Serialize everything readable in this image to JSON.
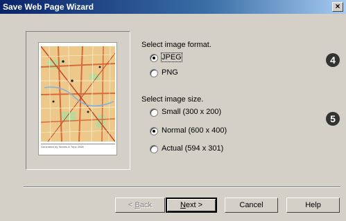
{
  "window": {
    "title": "Save Web Page Wizard",
    "close_glyph": "×"
  },
  "preview": {
    "caption": "Generated by Streets & Trips 2008"
  },
  "format": {
    "heading": "Select image format.",
    "options": [
      {
        "label": "JPEG",
        "selected": true
      },
      {
        "label": "PNG",
        "selected": false
      }
    ]
  },
  "size": {
    "heading": "Select image size.",
    "options": [
      {
        "label": "Small (300 x 200)",
        "selected": false
      },
      {
        "label": "Normal (600 x 400)",
        "selected": true
      },
      {
        "label": "Actual (594 x 301)",
        "selected": false
      }
    ]
  },
  "badges": [
    "4",
    "5"
  ],
  "buttons": {
    "back": {
      "prefix": "< ",
      "hotkey": "B",
      "rest": "ack"
    },
    "next": {
      "hotkey": "N",
      "rest": "ext >"
    },
    "cancel": "Cancel",
    "help": "Help"
  }
}
